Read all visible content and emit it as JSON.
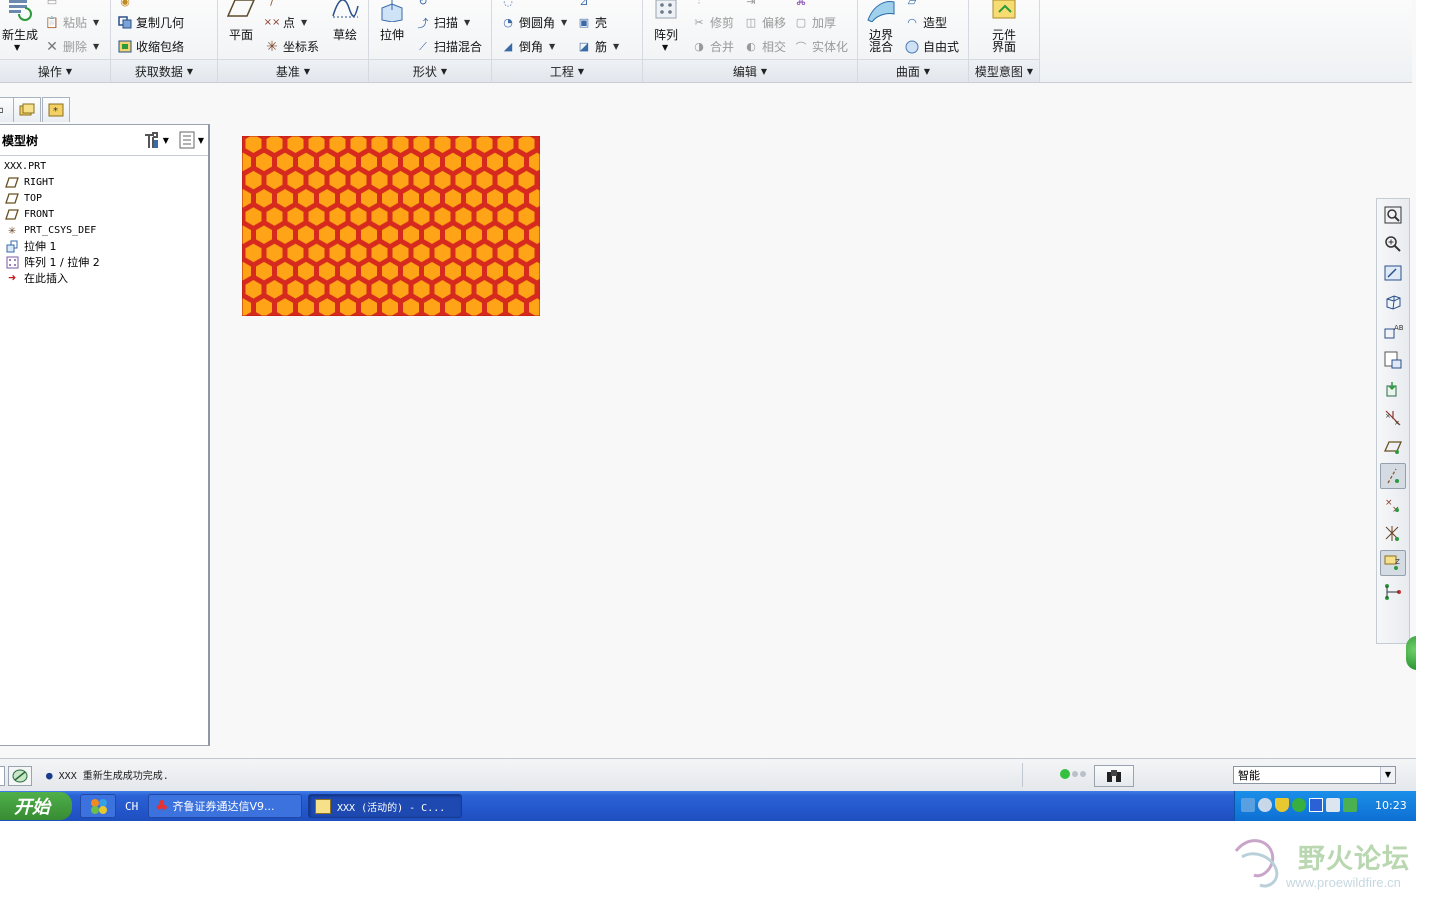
{
  "ribbon": {
    "groups": {
      "operations": "操作",
      "get_data": "获取数据",
      "datum": "基准",
      "shapes": "形状",
      "engineering": "工程",
      "editing": "编辑",
      "surfaces": "曲面",
      "model_intent": "模型意图"
    },
    "operations": {
      "regenerate": "新生成",
      "paste": "粘贴",
      "delete": "删除"
    },
    "get_data": {
      "copy_geometry": "复制几何",
      "shrinkwrap": "收缩包络"
    },
    "datum": {
      "plane": "平面",
      "point": "点",
      "csys": "坐标系",
      "sketch": "草绘"
    },
    "shapes": {
      "extrude": "拉伸",
      "sweep": "扫描",
      "swept_blend": "扫描混合"
    },
    "engineering": {
      "round": "倒圆角",
      "chamfer": "倒角",
      "shell": "壳",
      "rib": "筋"
    },
    "editing": {
      "pattern": "阵列",
      "trim": "修剪",
      "offset": "偏移",
      "thicken": "加厚",
      "merge": "合并",
      "intersect": "相交",
      "solidify": "实体化"
    },
    "surfaces": {
      "boundary_blend_1": "边界",
      "boundary_blend_2": "混合",
      "style": "造型",
      "freestyle": "自由式"
    },
    "model_intent": {
      "component_interface_1": "元件",
      "component_interface_2": "界面"
    }
  },
  "model_tree": {
    "title": "模型树",
    "items": [
      {
        "icon": "part-icon",
        "label": "XXX.PRT"
      },
      {
        "icon": "datum-plane-icon",
        "label": "RIGHT"
      },
      {
        "icon": "datum-plane-icon",
        "label": "TOP"
      },
      {
        "icon": "datum-plane-icon",
        "label": "FRONT"
      },
      {
        "icon": "csys-icon",
        "label": "PRT_CSYS_DEF"
      },
      {
        "icon": "extrude-icon",
        "label": "拉伸 1"
      },
      {
        "icon": "pattern-icon",
        "label": "阵列 1 / 拉伸 2"
      },
      {
        "icon": "insert-here-icon",
        "label": "在此插入"
      }
    ]
  },
  "model_view": {
    "plate_color": "#d62a1e",
    "cell_color": "#ffa416"
  },
  "status_bar": {
    "message": "XXX 重新生成成功完成.",
    "filter_value": "智能"
  },
  "taskbar": {
    "start": "开始",
    "lang": "CH",
    "tasks": [
      "齐鲁证券通达信V9...",
      "XXX (活动的) - C..."
    ],
    "clock": "10:23"
  },
  "watermark": {
    "title": "野火论坛",
    "url": "www.proewildfire.cn"
  }
}
